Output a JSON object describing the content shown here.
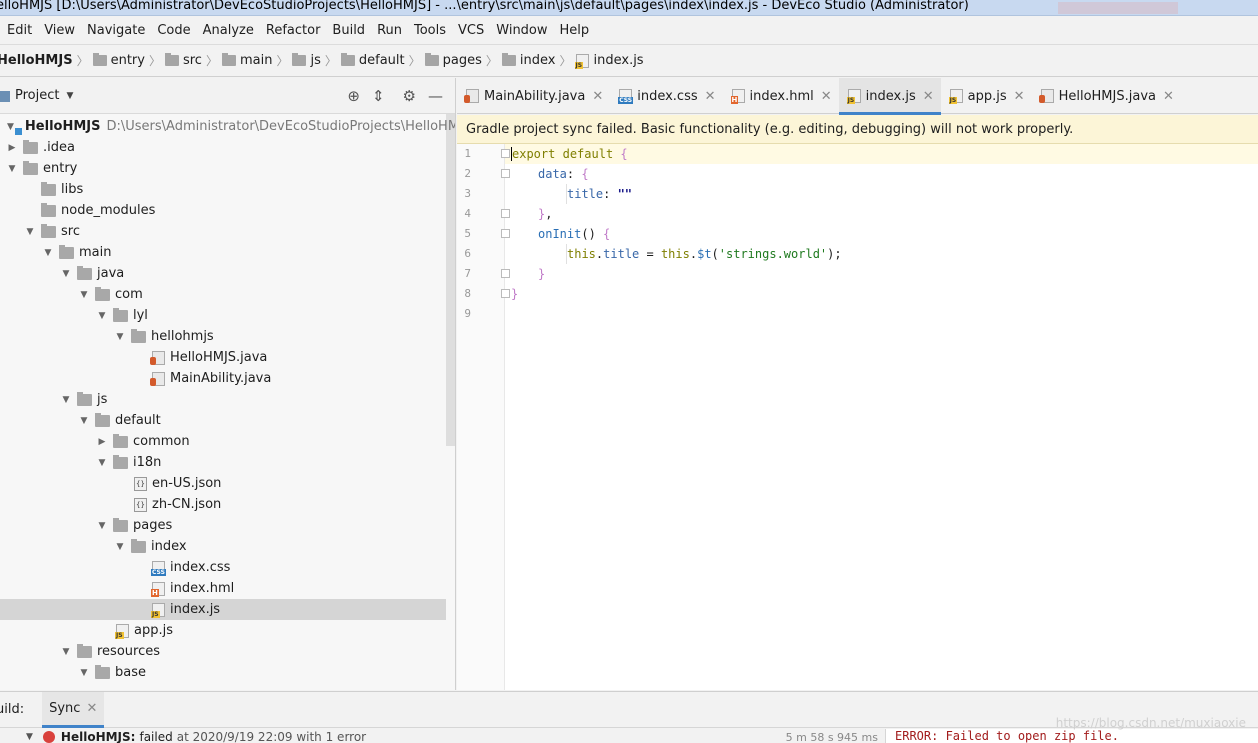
{
  "window": {
    "title": "elloHMJS [D:\\Users\\Administrator\\DevEcoStudioProjects\\HelloHMJS] - ...\\entry\\src\\main\\js\\default\\pages\\index\\index.js - DevEco Studio (Administrator)"
  },
  "menu": [
    "Edit",
    "View",
    "Navigate",
    "Code",
    "Analyze",
    "Refactor",
    "Build",
    "Run",
    "Tools",
    "VCS",
    "Window",
    "Help"
  ],
  "breadcrumb": [
    "HelloHMJS",
    "entry",
    "src",
    "main",
    "js",
    "default",
    "pages",
    "index",
    "index.js"
  ],
  "project_panel": {
    "label": "Project",
    "tree": [
      {
        "label": "HelloHMJS",
        "path": "D:\\Users\\Administrator\\DevEcoStudioProjects\\HelloHMJS"
      },
      {
        "label": ".idea"
      },
      {
        "label": "entry"
      },
      {
        "label": "libs"
      },
      {
        "label": "node_modules"
      },
      {
        "label": "src"
      },
      {
        "label": "main"
      },
      {
        "label": "java"
      },
      {
        "label": "com"
      },
      {
        "label": "lyl"
      },
      {
        "label": "hellohmjs"
      },
      {
        "label": "HelloHMJS.java"
      },
      {
        "label": "MainAbility.java"
      },
      {
        "label": "js"
      },
      {
        "label": "default"
      },
      {
        "label": "common"
      },
      {
        "label": "i18n"
      },
      {
        "label": "en-US.json"
      },
      {
        "label": "zh-CN.json"
      },
      {
        "label": "pages"
      },
      {
        "label": "index"
      },
      {
        "label": "index.css"
      },
      {
        "label": "index.hml"
      },
      {
        "label": "index.js"
      },
      {
        "label": "app.js"
      },
      {
        "label": "resources"
      },
      {
        "label": "base"
      }
    ]
  },
  "tabs": [
    {
      "label": "MainAbility.java",
      "icon": "java-file-icon"
    },
    {
      "label": "index.css",
      "icon": "css-file-icon"
    },
    {
      "label": "index.hml",
      "icon": "hml-file-icon"
    },
    {
      "label": "index.js",
      "icon": "js-file-icon",
      "active": true
    },
    {
      "label": "app.js",
      "icon": "js-file-icon"
    },
    {
      "label": "HelloHMJS.java",
      "icon": "java-file-icon"
    }
  ],
  "banner": "Gradle project sync failed. Basic functionality (e.g. editing, debugging) will not work properly.",
  "editor": {
    "line_numbers": [
      "1",
      "2",
      "3",
      "4",
      "5",
      "6",
      "7",
      "8",
      "9"
    ]
  },
  "build": {
    "label": "uild:",
    "tab": "Sync",
    "project": "HelloHMJS:",
    "status": "failed",
    "detail": "at 2020/9/19 22:09 with 1 error",
    "duration": "5 m 58 s 945 ms",
    "error": "ERROR: Failed to open zip file.",
    "watermark": "https://blog.csdn.net/muxiaoxie"
  },
  "colors": {
    "accent": "#4083c9",
    "banner_bg": "#fcf5d7",
    "error": "#d9413c"
  }
}
